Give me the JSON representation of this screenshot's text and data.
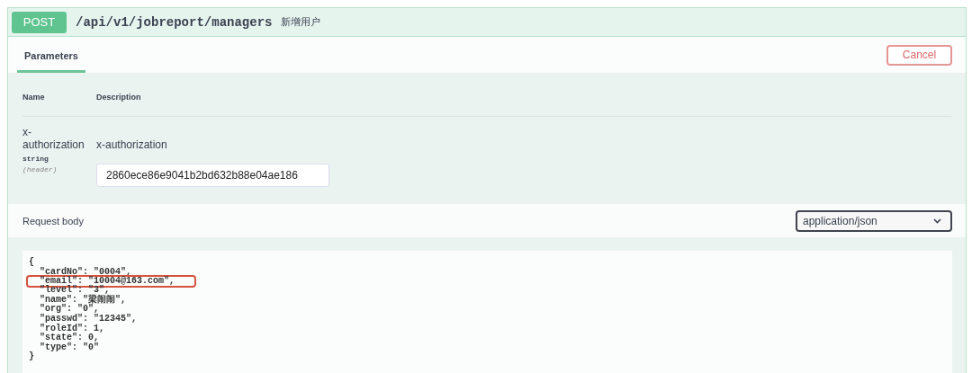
{
  "operation": {
    "method": "POST",
    "path": "/api/v1/jobreport/managers",
    "summary": "新增用户"
  },
  "tabs": [
    {
      "label": "Parameters",
      "selected": true
    }
  ],
  "cancel_button": "Cancel",
  "parameters": {
    "columns": [
      "Name",
      "Description"
    ],
    "rows": [
      {
        "name_lines": [
          "x-",
          "authorization"
        ],
        "type": "string",
        "location": "(header)",
        "description": "x-authorization",
        "value": "2860ece86e9041b2bd632b88e04ae186"
      }
    ]
  },
  "request_body": {
    "label": "Request body",
    "content_type": "application/json",
    "lines": [
      {
        "text": "{",
        "highlighted": false
      },
      {
        "text": "  \"cardNo\": \"0004\",",
        "highlighted": false
      },
      {
        "text": "  \"email\": \"10004@163.com\",",
        "highlighted": true
      },
      {
        "text": "  \"level\": \"3\",",
        "highlighted": false
      },
      {
        "text": "  \"name\": \"梁闹闹\",",
        "highlighted": false
      },
      {
        "text": "  \"org\": \"0\",",
        "highlighted": false
      },
      {
        "text": "  \"passwd\": \"12345\",",
        "highlighted": false
      },
      {
        "text": "  \"roleId\": 1,",
        "highlighted": false
      },
      {
        "text": "  \"state\": 0,",
        "highlighted": false
      },
      {
        "text": "  \"type\": \"0\"",
        "highlighted": false
      },
      {
        "text": "}",
        "highlighted": false
      }
    ]
  }
}
